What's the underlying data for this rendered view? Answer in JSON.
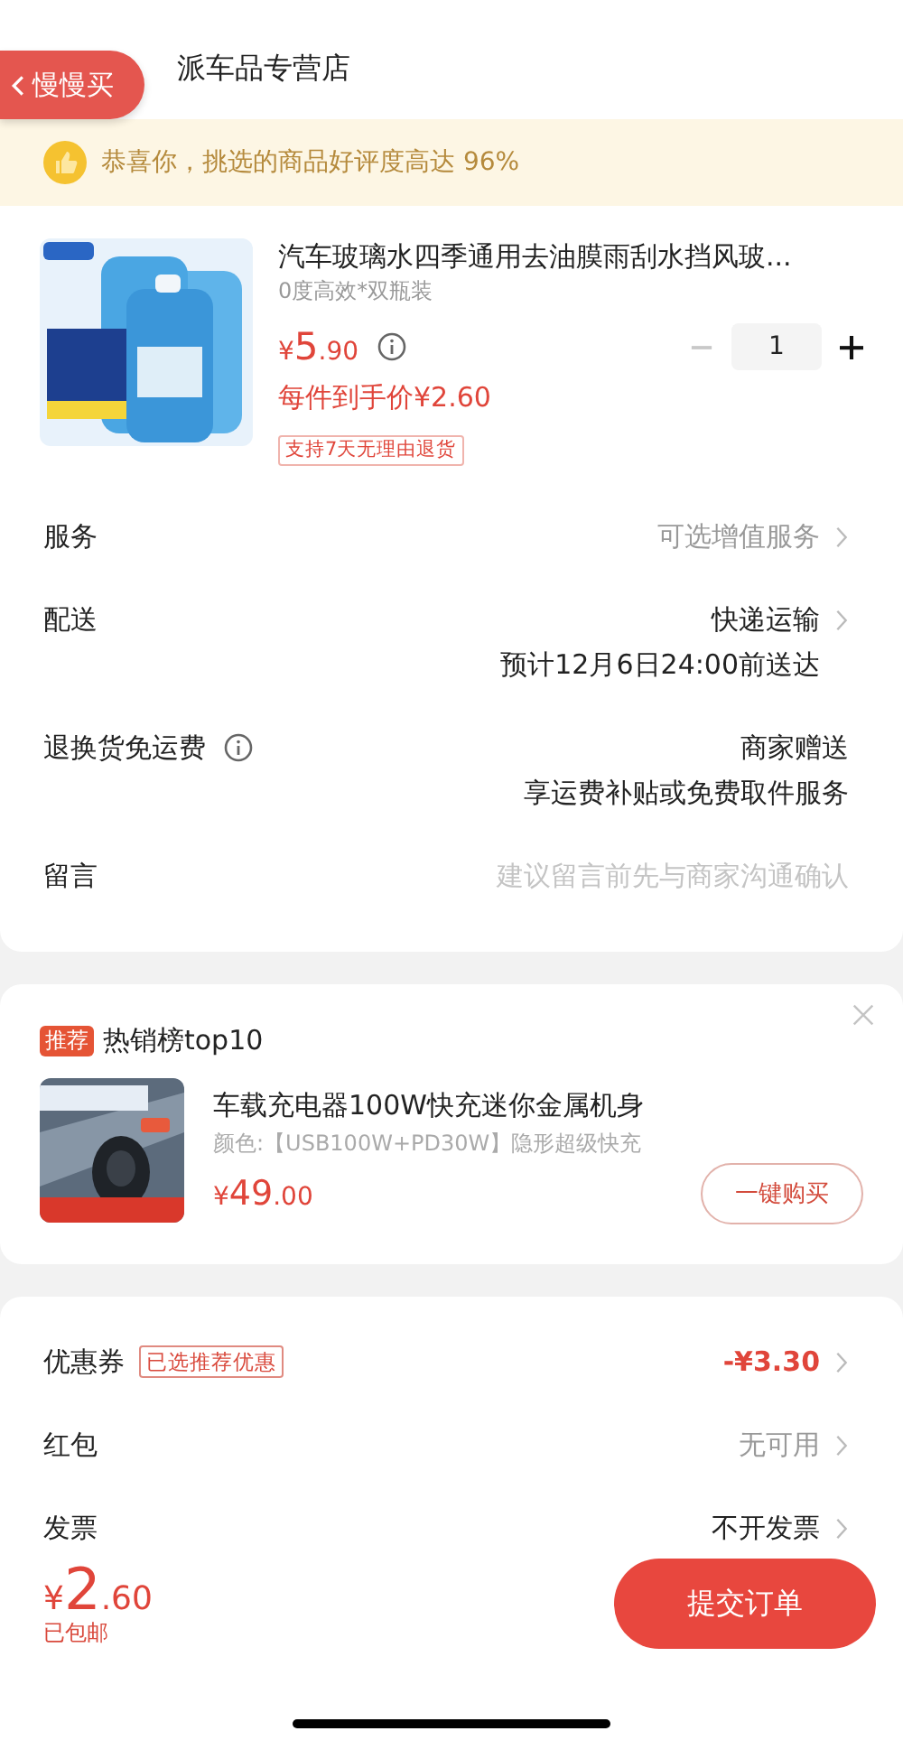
{
  "store": {
    "name": "派车品专营店"
  },
  "back_button": {
    "label": "慢慢买"
  },
  "banner": {
    "text": "恭喜你，挑选的商品好评度高达 96%"
  },
  "product": {
    "title": "汽车玻璃水四季通用去油膜雨刮水挡风玻...",
    "spec": "0度高效*双瓶装",
    "currency": "¥",
    "price_int": "5",
    "price_dec": ".90",
    "minus_disabled": true,
    "quantity": "1",
    "final_price": "每件到手价¥2.60",
    "tag": "支持7天无理由退货"
  },
  "order_rows": [
    {
      "label": "服务",
      "info": false,
      "value": "可选增值服务",
      "kind": "muted",
      "chevron": true
    },
    {
      "label": "配送",
      "info": false,
      "value": "快递运输",
      "sub": "预计12月6日24:00前送达",
      "kind": "dark",
      "chevron": true
    },
    {
      "label": "退换货免运费",
      "info": true,
      "value": "商家赠送",
      "sub": "享运费补贴或免费取件服务",
      "kind": "dark",
      "chevron": false
    },
    {
      "label": "留言",
      "info": false,
      "value": "建议留言前先与商家沟通确认",
      "kind": "placeholder",
      "chevron": false
    }
  ],
  "recommend": {
    "badge": "推荐",
    "title": "热销榜top10",
    "product_title": "车载充电器100W快充迷你金属机身",
    "spec": "颜色:【USB100W+PD30W】隐形超级快充",
    "currency": "¥",
    "price_int": "49",
    "price_dec": ".00",
    "button": "一键购买"
  },
  "discount_rows": [
    {
      "label": "优惠券",
      "badge": "已选推荐优惠",
      "value": "-¥3.30",
      "kind": "red",
      "chevron": true
    },
    {
      "label": "红包",
      "value": "无可用",
      "kind": "muted",
      "chevron": true
    },
    {
      "label": "发票",
      "value": "不开发票",
      "kind": "dark",
      "chevron": true
    }
  ],
  "footer": {
    "currency": "¥",
    "price_int": "2",
    "price_dec": ".60",
    "note": "已包邮",
    "submit": "提交订单"
  }
}
